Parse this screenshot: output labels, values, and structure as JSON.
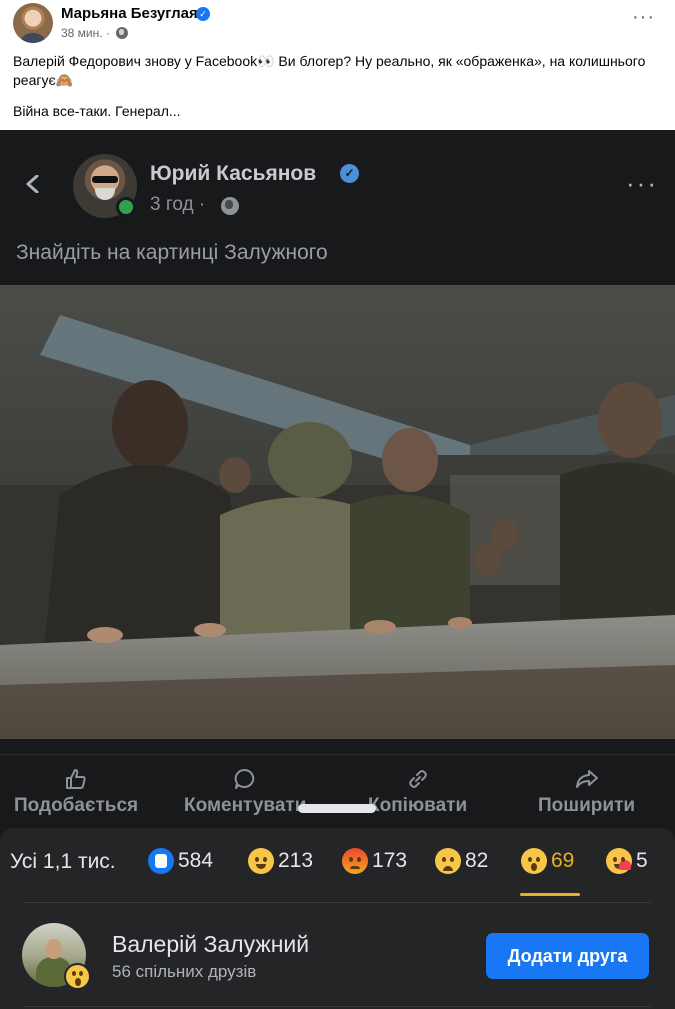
{
  "outer_post": {
    "author": "Марьяна Безуглая",
    "time": "38 мин. ·",
    "line1": "Валерій Федорович знову у Facebook👀 Ви блогер? Ну реально, як «ображенка», на колишнього реагує🙈",
    "line2": "Війна все-таки. Генерал..."
  },
  "inner_post": {
    "author": "Юрий Касьянов",
    "time": "3 год ·",
    "text": "Знайдіть на картинці Залужного"
  },
  "actions": {
    "like": "Подобається",
    "comment": "Коментувати",
    "copy": "Копіювати",
    "share": "Поширити"
  },
  "reactions": {
    "all": "Усі 1,1 тис.",
    "like": "584",
    "haha": "213",
    "angry": "173",
    "sad": "82",
    "wow": "69",
    "care": "5"
  },
  "reactor": {
    "name": "Валерій Залужний",
    "mutual": "56 спільних друзів",
    "button": "Додати друга"
  },
  "colors": {
    "accent_blue": "#1877f2",
    "wow_tab": "#e8b021",
    "dark_bg": "#18191a",
    "sheet_bg": "#242526"
  }
}
